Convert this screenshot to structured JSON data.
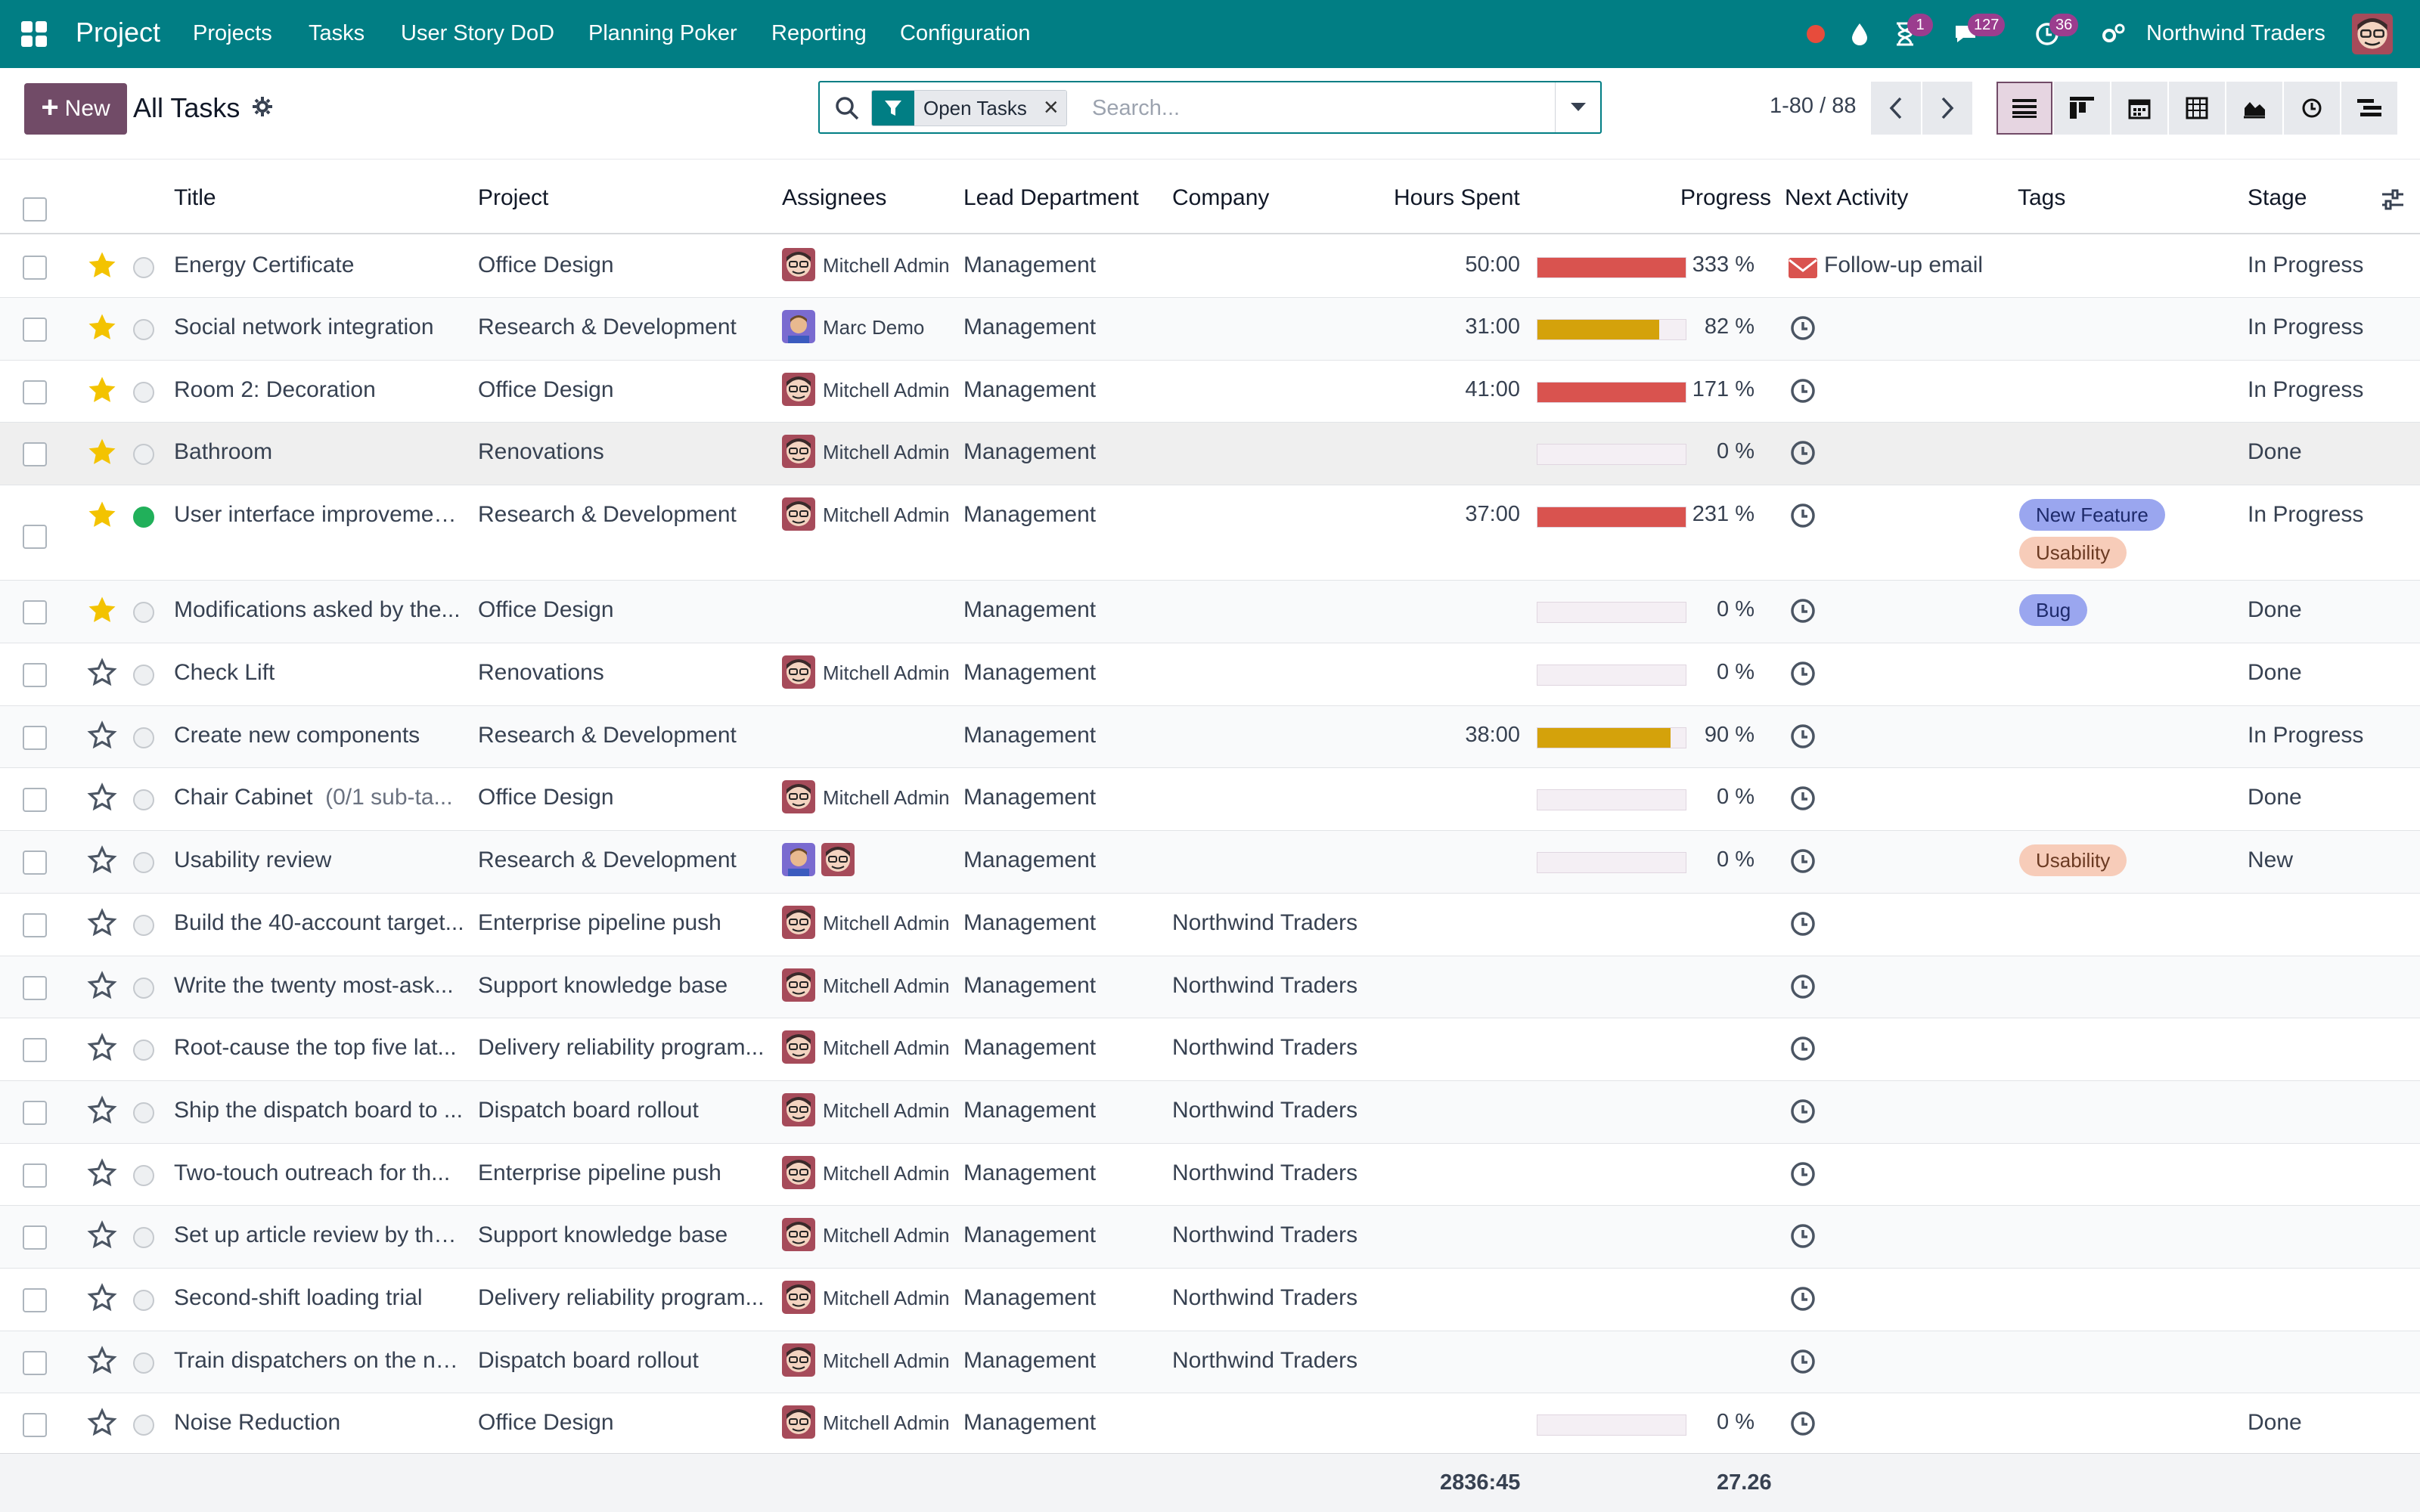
{
  "navbar": {
    "app_name": "Project",
    "menu": [
      "Projects",
      "Tasks",
      "User Story DoD",
      "Planning Poker",
      "Reporting",
      "Configuration"
    ],
    "badges": {
      "activity": "1",
      "messages": "127",
      "clock": "36"
    },
    "company": "Northwind Traders",
    "colors": {
      "bg": "#017e84",
      "badge": "#9b3d8e"
    }
  },
  "control": {
    "new_label": "New",
    "title": "All Tasks",
    "facet_label": "Open Tasks",
    "search_placeholder": "Search...",
    "pager": "1-80 / 88"
  },
  "columns": {
    "title": "Title",
    "project": "Project",
    "assignees": "Assignees",
    "lead_department": "Lead Department",
    "company": "Company",
    "hours_spent": "Hours Spent",
    "progress": "Progress",
    "next_activity": "Next Activity",
    "tags": "Tags",
    "stage": "Stage"
  },
  "rows": [
    {
      "title": "Energy Certificate",
      "starred": true,
      "state": "normal",
      "project": "Office Design",
      "assignee": "Mitchell Admin",
      "avatar": "admin",
      "department": "Management",
      "company": "",
      "hours": "50:00",
      "progress": "333 %",
      "progress_fraction": 1.0,
      "progress_color": "#d9534f",
      "activity": "Follow-up email",
      "activity_type": "email",
      "tags": [],
      "stage": "In Progress"
    },
    {
      "title": "Social network integration",
      "starred": true,
      "state": "normal",
      "project": "Research & Development",
      "assignee": "Marc Demo",
      "avatar": "demo",
      "department": "Management",
      "company": "",
      "hours": "31:00",
      "progress": "82 %",
      "progress_fraction": 0.82,
      "progress_color": "#d4a20b",
      "activity": "",
      "activity_type": "clock",
      "tags": [],
      "stage": "In Progress"
    },
    {
      "title": "Room 2: Decoration",
      "starred": true,
      "state": "normal",
      "project": "Office Design",
      "assignee": "Mitchell Admin",
      "avatar": "admin",
      "department": "Management",
      "company": "",
      "hours": "41:00",
      "progress": "171 %",
      "progress_fraction": 1.0,
      "progress_color": "#d9534f",
      "activity": "",
      "activity_type": "clock",
      "tags": [],
      "stage": "In Progress"
    },
    {
      "title": "Bathroom",
      "starred": true,
      "state": "normal",
      "project": "Renovations",
      "assignee": "Mitchell Admin",
      "avatar": "admin",
      "department": "Management",
      "company": "",
      "hours": "",
      "progress": "0 %",
      "progress_fraction": 0,
      "progress_color": "#d9534f",
      "activity": "",
      "activity_type": "clock",
      "tags": [],
      "stage": "Done"
    },
    {
      "title": "User interface improvemen...",
      "starred": true,
      "state": "done",
      "project": "Research & Development",
      "assignee": "Mitchell Admin",
      "avatar": "admin",
      "department": "Management",
      "company": "",
      "hours": "37:00",
      "progress": "231 %",
      "progress_fraction": 1.0,
      "progress_color": "#d9534f",
      "activity": "",
      "activity_type": "clock",
      "tags": [
        "New Feature",
        "Usability"
      ],
      "stage": "In Progress"
    },
    {
      "title": "Modifications asked by the...",
      "starred": true,
      "state": "normal",
      "project": "Office Design",
      "assignee": "",
      "avatar": "",
      "department": "Management",
      "company": "",
      "hours": "",
      "progress": "0 %",
      "progress_fraction": 0,
      "progress_color": "#d9534f",
      "activity": "",
      "activity_type": "clock",
      "tags": [
        "Bug"
      ],
      "stage": "Done"
    },
    {
      "title": "Check Lift",
      "starred": false,
      "state": "normal",
      "project": "Renovations",
      "assignee": "Mitchell Admin",
      "avatar": "admin",
      "department": "Management",
      "company": "",
      "hours": "",
      "progress": "0 %",
      "progress_fraction": 0,
      "progress_color": "#d9534f",
      "activity": "",
      "activity_type": "clock",
      "tags": [],
      "stage": "Done"
    },
    {
      "title": "Create new components",
      "starred": false,
      "state": "normal",
      "project": "Research & Development",
      "assignee": "",
      "avatar": "",
      "department": "Management",
      "company": "",
      "hours": "38:00",
      "progress": "90 %",
      "progress_fraction": 0.9,
      "progress_color": "#d4a20b",
      "activity": "",
      "activity_type": "clock",
      "tags": [],
      "stage": "In Progress"
    },
    {
      "title": "Chair Cabinet",
      "subtitle": "(0/1 sub-ta...",
      "starred": false,
      "state": "normal",
      "project": "Office Design",
      "assignee": "Mitchell Admin",
      "avatar": "admin",
      "department": "Management",
      "company": "",
      "hours": "",
      "progress": "0 %",
      "progress_fraction": 0,
      "progress_color": "#d9534f",
      "activity": "",
      "activity_type": "clock",
      "tags": [],
      "stage": "Done"
    },
    {
      "title": "Usability review",
      "starred": false,
      "state": "normal",
      "project": "Research & Development",
      "assignee": "",
      "avatar": "both",
      "department": "Management",
      "company": "",
      "hours": "",
      "progress": "0 %",
      "progress_fraction": 0,
      "progress_color": "#d9534f",
      "activity": "",
      "activity_type": "clock",
      "tags": [
        "Usability"
      ],
      "stage": "New"
    },
    {
      "title": "Build the 40-account target...",
      "starred": false,
      "state": "normal",
      "project": "Enterprise pipeline push",
      "assignee": "Mitchell Admin",
      "avatar": "admin",
      "department": "Management",
      "company": "Northwind Traders",
      "hours": "",
      "progress": "",
      "progress_fraction": null,
      "progress_color": "",
      "activity": "",
      "activity_type": "clock",
      "tags": [],
      "stage": ""
    },
    {
      "title": "Write the twenty most-ask...",
      "starred": false,
      "state": "normal",
      "project": "Support knowledge base",
      "assignee": "Mitchell Admin",
      "avatar": "admin",
      "department": "Management",
      "company": "Northwind Traders",
      "hours": "",
      "progress": "",
      "progress_fraction": null,
      "progress_color": "",
      "activity": "",
      "activity_type": "clock",
      "tags": [],
      "stage": ""
    },
    {
      "title": "Root-cause the top five lat...",
      "starred": false,
      "state": "normal",
      "project": "Delivery reliability program...",
      "assignee": "Mitchell Admin",
      "avatar": "admin",
      "department": "Management",
      "company": "Northwind Traders",
      "hours": "",
      "progress": "",
      "progress_fraction": null,
      "progress_color": "",
      "activity": "",
      "activity_type": "clock",
      "tags": [],
      "stage": ""
    },
    {
      "title": "Ship the dispatch board to ...",
      "starred": false,
      "state": "normal",
      "project": "Dispatch board rollout",
      "assignee": "Mitchell Admin",
      "avatar": "admin",
      "department": "Management",
      "company": "Northwind Traders",
      "hours": "",
      "progress": "",
      "progress_fraction": null,
      "progress_color": "",
      "activity": "",
      "activity_type": "clock",
      "tags": [],
      "stage": ""
    },
    {
      "title": "Two-touch outreach for th...",
      "starred": false,
      "state": "normal",
      "project": "Enterprise pipeline push",
      "assignee": "Mitchell Admin",
      "avatar": "admin",
      "department": "Management",
      "company": "Northwind Traders",
      "hours": "",
      "progress": "",
      "progress_fraction": null,
      "progress_color": "",
      "activity": "",
      "activity_type": "clock",
      "tags": [],
      "stage": ""
    },
    {
      "title": "Set up article review by the...",
      "starred": false,
      "state": "normal",
      "project": "Support knowledge base",
      "assignee": "Mitchell Admin",
      "avatar": "admin",
      "department": "Management",
      "company": "Northwind Traders",
      "hours": "",
      "progress": "",
      "progress_fraction": null,
      "progress_color": "",
      "activity": "",
      "activity_type": "clock",
      "tags": [],
      "stage": ""
    },
    {
      "title": "Second-shift loading trial",
      "starred": false,
      "state": "normal",
      "project": "Delivery reliability program...",
      "assignee": "Mitchell Admin",
      "avatar": "admin",
      "department": "Management",
      "company": "Northwind Traders",
      "hours": "",
      "progress": "",
      "progress_fraction": null,
      "progress_color": "",
      "activity": "",
      "activity_type": "clock",
      "tags": [],
      "stage": ""
    },
    {
      "title": "Train dispatchers on the ne...",
      "starred": false,
      "state": "normal",
      "project": "Dispatch board rollout",
      "assignee": "Mitchell Admin",
      "avatar": "admin",
      "department": "Management",
      "company": "Northwind Traders",
      "hours": "",
      "progress": "",
      "progress_fraction": null,
      "progress_color": "",
      "activity": "",
      "activity_type": "clock",
      "tags": [],
      "stage": ""
    },
    {
      "title": "Noise Reduction",
      "starred": false,
      "state": "normal",
      "project": "Office Design",
      "assignee": "Mitchell Admin",
      "avatar": "admin",
      "department": "Management",
      "company": "",
      "hours": "",
      "progress": "0 %",
      "progress_fraction": 0,
      "progress_color": "#d9534f",
      "activity": "",
      "activity_type": "clock",
      "tags": [],
      "stage": "Done"
    }
  ],
  "footer": {
    "hours_total": "2836:45",
    "progress_total": "27.26"
  }
}
